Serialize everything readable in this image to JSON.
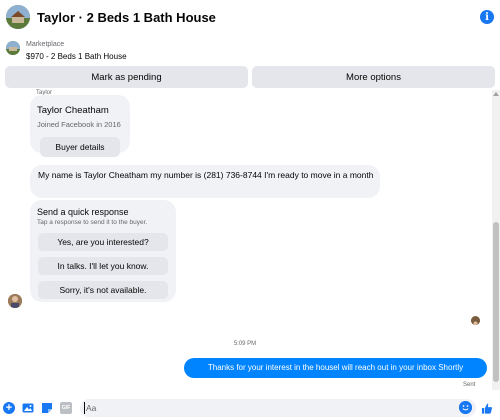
{
  "header": {
    "title": "Taylor · 2 Beds 1 Bath House",
    "info_glyph": "i",
    "avatar_icon": "house-photo"
  },
  "listing": {
    "label": "Marketplace",
    "subtitle": "$970 - 2 Beds 1 Bath House",
    "buttons": {
      "mark_pending": "Mark as pending",
      "more_options": "More options"
    }
  },
  "thread": {
    "sender_label": "Taylor",
    "profile_card": {
      "name": "Taylor Cheatham",
      "joined": "Joined Facebook in 2016",
      "button": "Buyer details"
    },
    "incoming_message": "My name is Taylor Cheatham my number is (281) 736-8744 I'm ready to move in a month",
    "quick_response": {
      "title": "Send a quick response",
      "subtitle": "Tap a response to send it to the buyer.",
      "options": [
        "Yes, are you interested?",
        "In talks. I'll let you know.",
        "Sorry, it's not available."
      ]
    },
    "timestamp": "5:09 PM",
    "outgoing_message": "Thanks for your interest in the housel will reach out in your inbox Shortly",
    "status": "Sent"
  },
  "composer": {
    "placeholder": "Aa",
    "gif_label": "GIF",
    "plus_glyph": "+"
  },
  "colors": {
    "accent": "#1877f2",
    "outgoing_bubble": "#0084ff",
    "incoming_bubble": "#f0f2f5",
    "button_gray": "#e4e6eb"
  }
}
